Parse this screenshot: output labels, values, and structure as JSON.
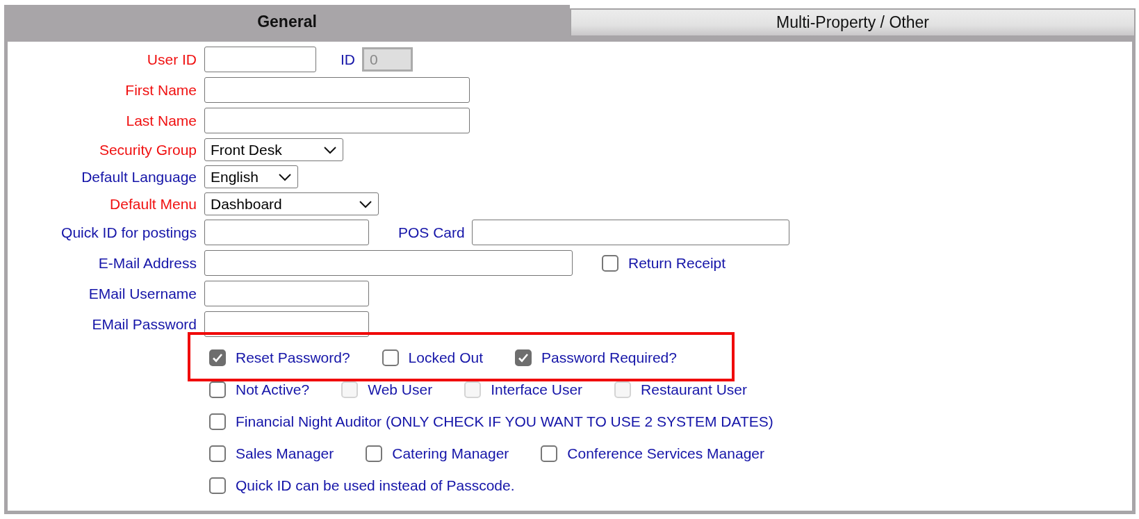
{
  "tabs": [
    {
      "label": "General",
      "selected": true
    },
    {
      "label": "Multi-Property / Other",
      "selected": false
    }
  ],
  "form_rows": [
    {
      "label": "User ID",
      "required": true,
      "field": {
        "kind": "text",
        "disabled": false
      },
      "extra": {
        "label": "ID",
        "required": false,
        "field": {
          "kind": "text",
          "value": "0",
          "disabled": true
        }
      }
    },
    {
      "label": "First Name",
      "required": true,
      "field": {
        "kind": "text",
        "disabled": false
      }
    },
    {
      "label": "Last Name",
      "required": true,
      "field": {
        "kind": "text",
        "disabled": false
      }
    },
    {
      "label": "Security Group",
      "required": true,
      "field": {
        "kind": "select",
        "value": "Front Desk",
        "disabled": false
      }
    },
    {
      "label": "Default Language",
      "required": false,
      "field": {
        "kind": "select",
        "value": "English",
        "disabled": false
      }
    },
    {
      "label": "Default Menu",
      "required": true,
      "field": {
        "kind": "select",
        "value": "Dashboard",
        "disabled": false
      }
    },
    {
      "label": "Quick ID for postings",
      "required": false,
      "field": {
        "kind": "text",
        "disabled": false
      },
      "extra": {
        "label": "POS Card",
        "required": false,
        "field": {
          "kind": "text",
          "disabled": false
        }
      }
    },
    {
      "label": "E-Mail Address",
      "required": false,
      "field": {
        "kind": "text",
        "disabled": false
      },
      "extra": {
        "label": "Return Receipt",
        "field": {
          "kind": "checkbox",
          "checked": false,
          "disabled": false
        }
      }
    },
    {
      "label": "EMail Username",
      "required": false,
      "field": {
        "kind": "text",
        "disabled": false
      }
    },
    {
      "label": "EMail Password",
      "required": false,
      "field": {
        "kind": "text",
        "disabled": false
      }
    }
  ],
  "checkbox_rows": [
    {
      "highlighted": true,
      "items": [
        {
          "label": "Reset Password?",
          "checked": true,
          "disabled": false
        },
        {
          "label": "Locked Out",
          "checked": false,
          "disabled": false
        },
        {
          "label": "Password Required?",
          "checked": true,
          "disabled": false
        }
      ]
    },
    {
      "highlighted": false,
      "items": [
        {
          "label": "Not Active?",
          "checked": false,
          "disabled": false
        },
        {
          "label": "Web User",
          "checked": false,
          "disabled": true
        },
        {
          "label": "Interface User",
          "checked": false,
          "disabled": true
        },
        {
          "label": "Restaurant User",
          "checked": false,
          "disabled": true
        }
      ]
    },
    {
      "highlighted": false,
      "items": [
        {
          "label": "Financial Night Auditor (ONLY CHECK IF YOU WANT TO USE 2 SYSTEM DATES)",
          "checked": false,
          "disabled": false
        }
      ]
    },
    {
      "highlighted": false,
      "items": [
        {
          "label": "Sales Manager",
          "checked": false,
          "disabled": false
        },
        {
          "label": "Catering Manager",
          "checked": false,
          "disabled": false
        },
        {
          "label": "Conference Services Manager",
          "checked": false,
          "disabled": false
        }
      ]
    },
    {
      "highlighted": false,
      "items": [
        {
          "label": "Quick ID can be used instead of Passcode.",
          "checked": false,
          "disabled": false
        }
      ]
    }
  ]
}
